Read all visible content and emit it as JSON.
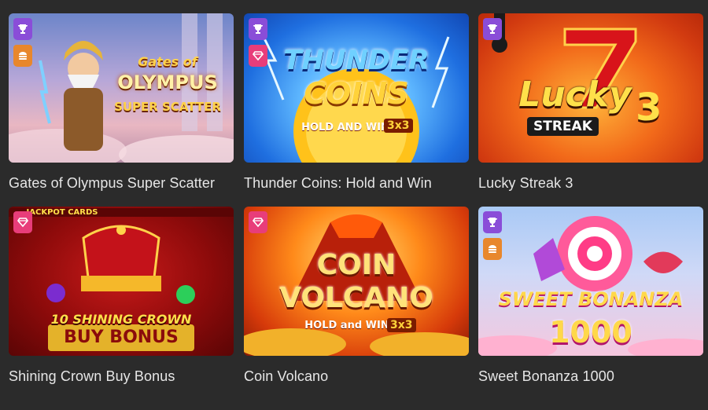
{
  "games": [
    {
      "title": "Gates of Olympus Super Scatter",
      "art": {
        "line1": "Gates of",
        "line2": "OLYMPUS",
        "line3": "SUPER SCATTER"
      },
      "badges": [
        "trophy-icon",
        "burger-icon"
      ]
    },
    {
      "title": "Thunder Coins: Hold and Win",
      "art": {
        "line1": "THUNDER",
        "line2": "COINS",
        "line3": "HOLD AND WIN",
        "line4": "3x3"
      },
      "badges": [
        "trophy-icon",
        "diamond-icon"
      ]
    },
    {
      "title": "Lucky Streak 3",
      "art": {
        "line1": "Lucky",
        "line2": "3",
        "line3": "STREAK"
      },
      "badges": [
        "trophy-icon"
      ]
    },
    {
      "title": "Shining Crown Buy Bonus",
      "art": {
        "line0": "JACKPOT CARDS",
        "line1": "10 SHINING CROWN",
        "line2": "BUY BONUS"
      },
      "badges": [
        "diamond-icon"
      ]
    },
    {
      "title": "Coin Volcano",
      "art": {
        "line1": "COIN",
        "line2": "VOLCANO",
        "line3": "HOLD and WIN",
        "line4": "3x3"
      },
      "badges": [
        "diamond-icon"
      ]
    },
    {
      "title": "Sweet Bonanza 1000",
      "art": {
        "line1": "SWEET BONANZA",
        "line2": "1000"
      },
      "badges": [
        "trophy-icon",
        "burger-icon"
      ]
    }
  ],
  "colors": {
    "background": "#2b2b2b",
    "trophy_badge": "#8a4dd8",
    "diamond_badge": "#e83d7a",
    "burger_badge": "#e8872c"
  }
}
